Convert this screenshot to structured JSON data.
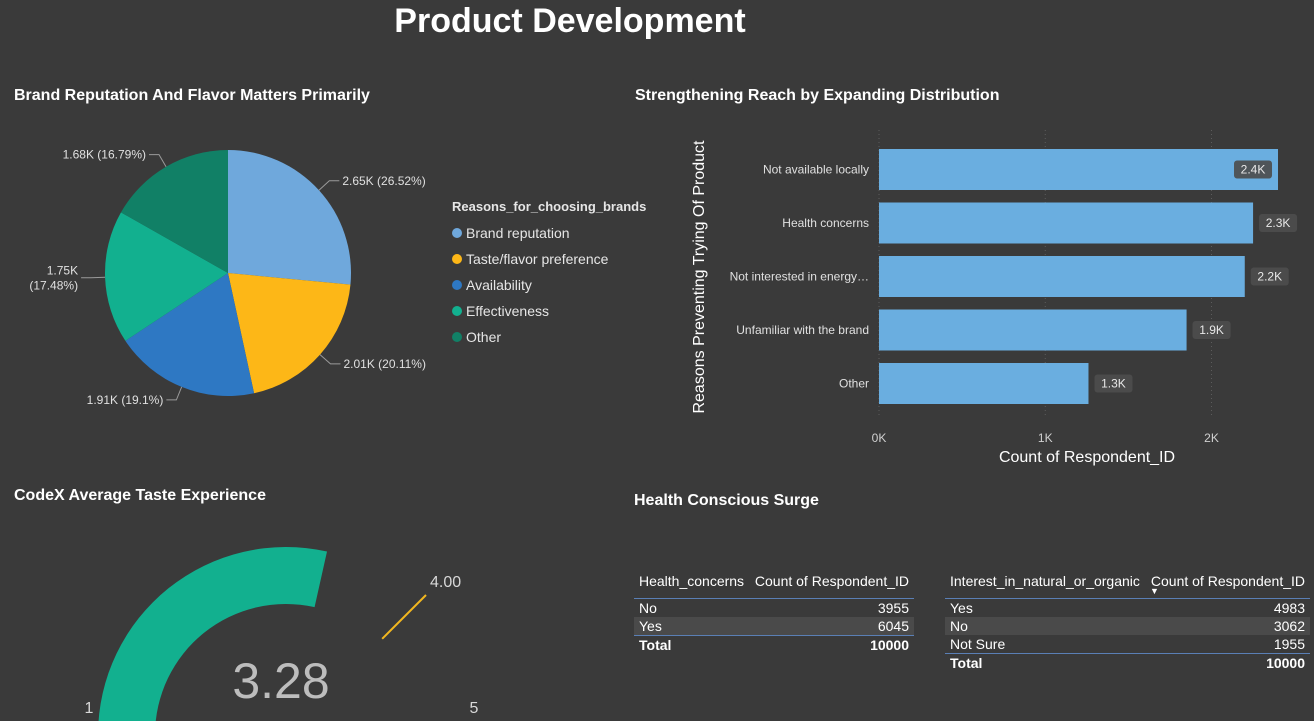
{
  "page": {
    "title": "Product Development"
  },
  "pie": {
    "title": "Brand Reputation And Flavor Matters Primarily",
    "legend_title": "Reasons_for_choosing_brands"
  },
  "bar": {
    "title": "Strengthening Reach by Expanding Distribution"
  },
  "gauge": {
    "title": "CodeX Average Taste Experience"
  },
  "tables": {
    "title": "Health Conscious Surge",
    "health": {
      "headers": [
        "Health_concerns",
        "Count of Respondent_ID"
      ],
      "rows": [
        [
          "No",
          "3955"
        ],
        [
          "Yes",
          "6045"
        ]
      ],
      "total": [
        "Total",
        "10000"
      ]
    },
    "interest": {
      "headers": [
        "Interest_in_natural_or_organic",
        "Count of Respondent_ID"
      ],
      "rows": [
        [
          "Yes",
          "4983"
        ],
        [
          "No",
          "3062"
        ],
        [
          "Not Sure",
          "1955"
        ]
      ],
      "total": [
        "Total",
        "10000"
      ]
    }
  },
  "chart_data": [
    {
      "type": "pie",
      "title": "Brand Reputation And Flavor Matters Primarily",
      "legend_title": "Reasons_for_choosing_brands",
      "legend_position": "right",
      "categories": [
        "Brand reputation",
        "Taste/flavor preference",
        "Availability",
        "Effectiveness",
        "Other"
      ],
      "values": [
        2650,
        2010,
        1910,
        1750,
        1680
      ],
      "data_labels": [
        "2.65K (26.52%)",
        "2.01K (20.11%)",
        "1.91K (19.1%)",
        "1.75K (17.48%)",
        "1.68K (16.79%)"
      ],
      "percents": [
        26.52,
        20.11,
        19.1,
        17.48,
        16.79
      ],
      "colors": [
        "#6fa8dc",
        "#fdb717",
        "#2e78c3",
        "#12b08f",
        "#118066"
      ]
    },
    {
      "type": "bar",
      "orientation": "horizontal",
      "title": "Strengthening Reach by Expanding Distribution",
      "xlabel": "Count of Respondent_ID",
      "ylabel": "Reasons Preventing Trying Of Product",
      "categories": [
        "Not available locally",
        "Health concerns",
        "Not interested in energy…",
        "Unfamiliar with the brand",
        "Other"
      ],
      "values": [
        2400,
        2250,
        2200,
        1850,
        1260
      ],
      "data_labels": [
        "2.4K",
        "2.3K",
        "2.2K",
        "1.9K",
        "1.3K"
      ],
      "xticks": [
        0,
        1000,
        2000
      ],
      "xtick_labels": [
        "0K",
        "1K",
        "2K"
      ],
      "xlim": [
        0,
        2430
      ],
      "grid": true,
      "color": "#6aaee0"
    },
    {
      "type": "gauge",
      "title": "CodeX Average Taste Experience",
      "value": 3.28,
      "value_label": "3.28",
      "min": 1,
      "max": 5,
      "min_label": "1",
      "max_label": "5",
      "target": 4.0,
      "target_label": "4.00",
      "color": "#12b08f",
      "target_color": "#f2b71f"
    }
  ]
}
